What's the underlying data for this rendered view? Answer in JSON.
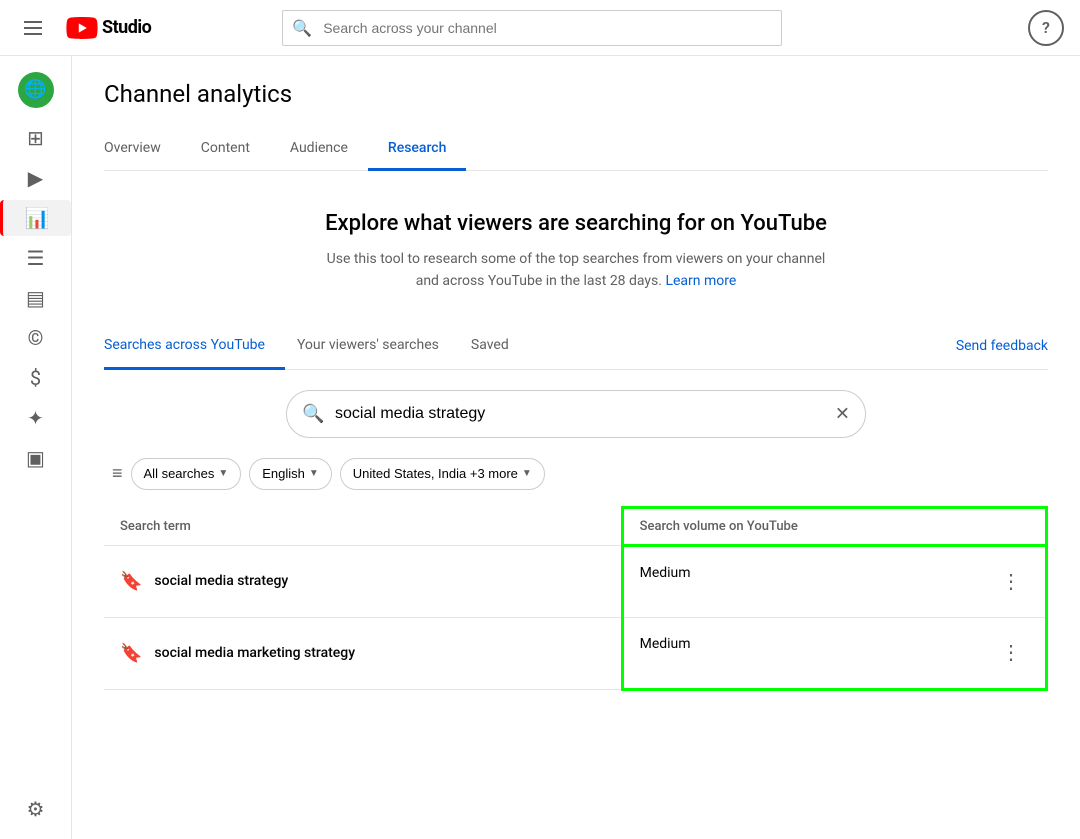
{
  "topbar": {
    "logo_text": "Studio",
    "search_placeholder": "Search across your channel",
    "help_label": "?"
  },
  "sidebar": {
    "items": [
      {
        "id": "globe",
        "icon": "🌐",
        "label": "",
        "active": false,
        "globe": true
      },
      {
        "id": "dashboard",
        "icon": "⊞",
        "label": ""
      },
      {
        "id": "video",
        "icon": "▶",
        "label": ""
      },
      {
        "id": "analytics",
        "icon": "📊",
        "label": "",
        "active_red": true
      },
      {
        "id": "comments",
        "icon": "☰",
        "label": ""
      },
      {
        "id": "subtitles",
        "icon": "▤",
        "label": ""
      },
      {
        "id": "copyright",
        "icon": "©",
        "label": ""
      },
      {
        "id": "monetize",
        "icon": "$",
        "label": ""
      },
      {
        "id": "customise",
        "icon": "✦",
        "label": ""
      },
      {
        "id": "library",
        "icon": "▣",
        "label": ""
      }
    ],
    "settings_icon": "⚙"
  },
  "page": {
    "title": "Channel analytics",
    "tabs": [
      {
        "id": "overview",
        "label": "Overview",
        "active": false
      },
      {
        "id": "content",
        "label": "Content",
        "active": false
      },
      {
        "id": "audience",
        "label": "Audience",
        "active": false
      },
      {
        "id": "research",
        "label": "Research",
        "active": true
      }
    ],
    "hero": {
      "heading": "Explore what viewers are searching for on YouTube",
      "description": "Use this tool to research some of the top searches from viewers on your channel and across YouTube in the last 28 days.",
      "learn_more": "Learn more"
    },
    "sub_tabs": [
      {
        "id": "searches-across",
        "label": "Searches across YouTube",
        "active": true
      },
      {
        "id": "viewers-searches",
        "label": "Your viewers' searches",
        "active": false
      },
      {
        "id": "saved",
        "label": "Saved",
        "active": false
      }
    ],
    "send_feedback": "Send feedback",
    "search_value": "social media strategy",
    "filters": {
      "filter_icon": "≡",
      "all_searches": "All searches",
      "language": "English",
      "region": "United States, India +3 more"
    },
    "table": {
      "headers": [
        {
          "id": "search-term",
          "label": "Search term"
        },
        {
          "id": "search-volume",
          "label": "Search volume on YouTube"
        }
      ],
      "rows": [
        {
          "id": 1,
          "term": "social media strategy",
          "volume": "Medium"
        },
        {
          "id": 2,
          "term": "social media marketing strategy",
          "volume": "Medium"
        }
      ]
    }
  }
}
